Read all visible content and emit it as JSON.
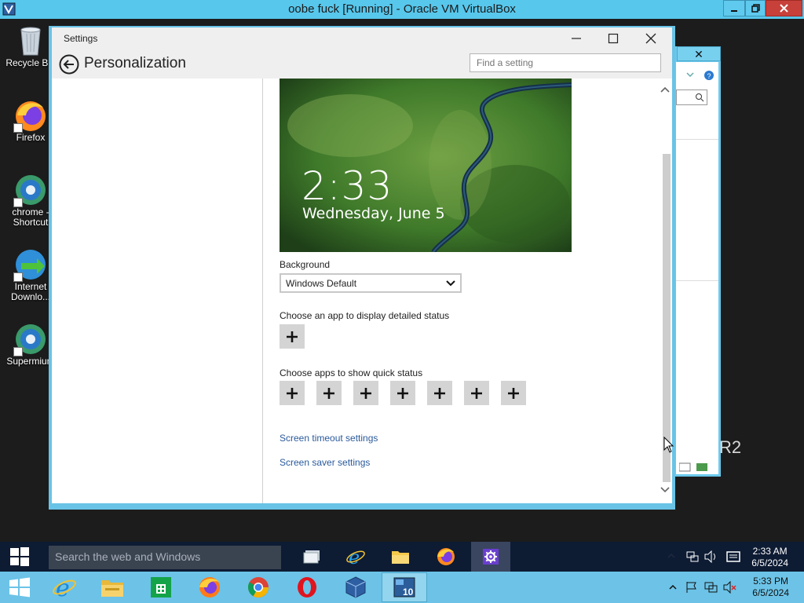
{
  "host_window": {
    "title": "oobe fuck [Running] - Oracle VM VirtualBox"
  },
  "desktop": {
    "icons": [
      {
        "label": "Recycle Bin"
      },
      {
        "label": "Firefox"
      },
      {
        "label": "chrome - Shortcut"
      },
      {
        "label": "Internet Downlo..."
      },
      {
        "label": "Supermium"
      }
    ],
    "background_text": "R2"
  },
  "settings": {
    "window_title": "Settings",
    "page_title": "Personalization",
    "search_placeholder": "Find a setting",
    "lock_screen_preview": {
      "time": "2:33",
      "date": "Wednesday, June 5"
    },
    "background_label": "Background",
    "background_value": "Windows Default",
    "detailed_status_label": "Choose an app to display detailed status",
    "quick_status_label": "Choose apps to show quick status",
    "quick_status_slot_count": 7,
    "links": {
      "screen_timeout": "Screen timeout settings",
      "screen_saver": "Screen saver settings"
    }
  },
  "guest_taskbar": {
    "search_placeholder": "Search the web and Windows",
    "apps": [
      "task-view",
      "internet-explorer",
      "file-explorer",
      "firefox",
      "settings"
    ],
    "active_app": "settings",
    "clock": {
      "time": "2:33 AM",
      "date": "6/5/2024"
    }
  },
  "host_taskbar": {
    "apps": [
      "internet-explorer",
      "file-explorer",
      "store",
      "firefox",
      "chrome",
      "opera",
      "virtualbox",
      "windows-10-vm"
    ],
    "active_app": "windows-10-vm",
    "clock": {
      "time": "5:33 PM",
      "date": "6/5/2024"
    }
  },
  "colors": {
    "host_accent": "#58c7ec",
    "link": "#2a5a9c",
    "guest_taskbar": "#0d1b33"
  }
}
